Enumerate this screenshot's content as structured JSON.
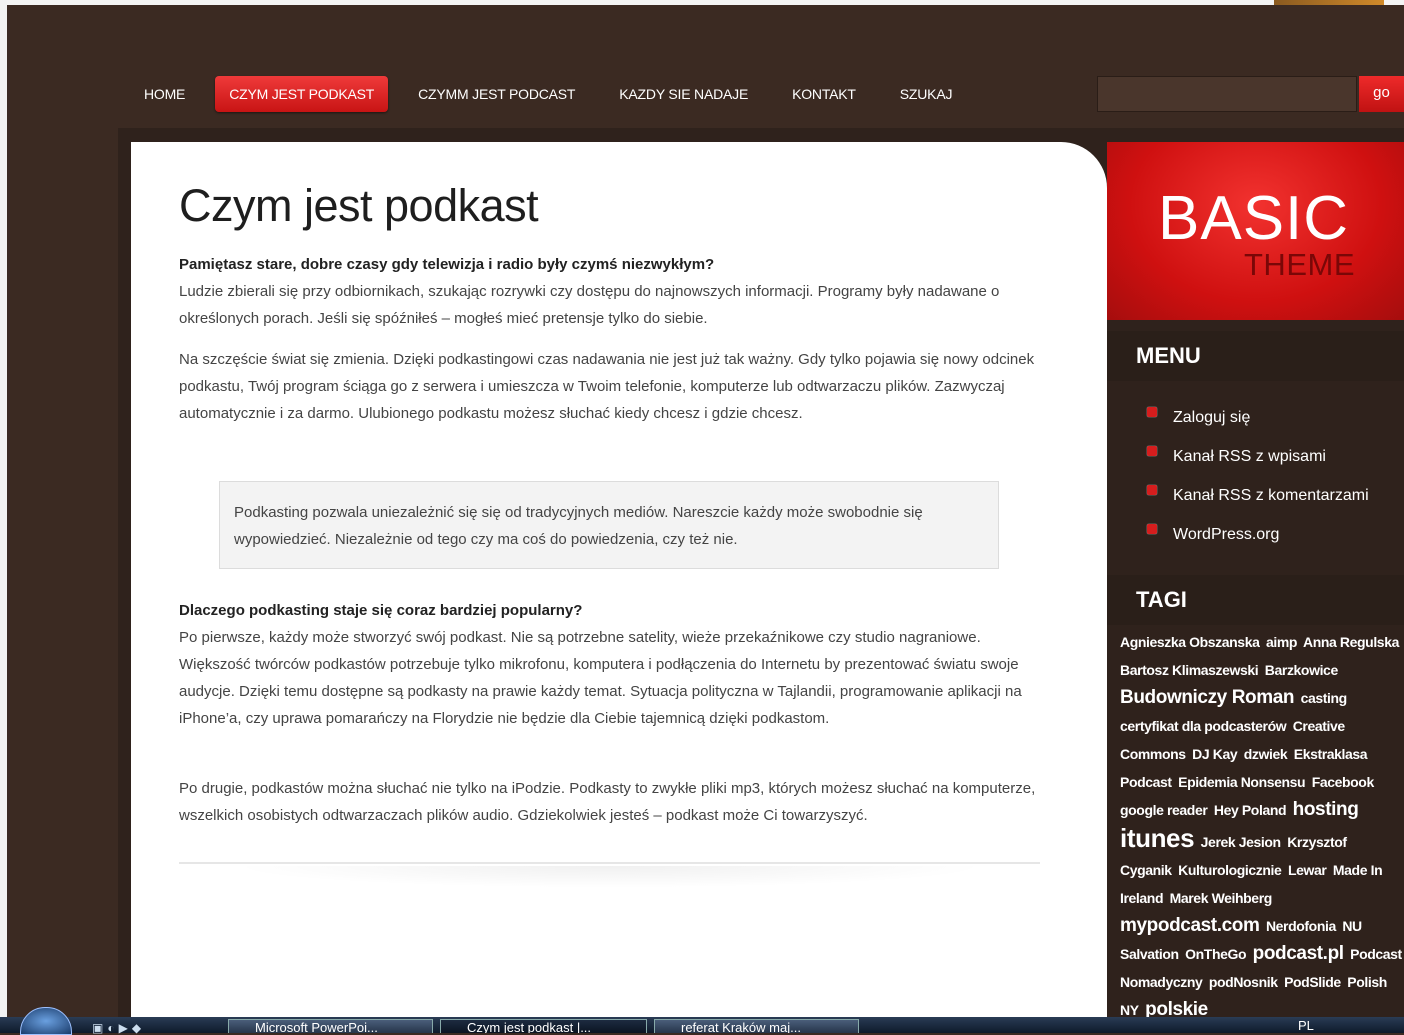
{
  "nav": {
    "items": [
      "HOME",
      "CZYM JEST PODKAST",
      "CZYMM JEST PODCAST",
      "KAZDY SIE NADAJE",
      "KONTAKT",
      "SZUKAJ"
    ],
    "active_index": 1
  },
  "search": {
    "button_label": "go",
    "value": ""
  },
  "page": {
    "title": "Czym jest podkast",
    "p1_bold": "Pamiętasz stare, dobre czasy gdy telewizja i radio były czymś niezwykłym?",
    "p1_text": "Ludzie zbierali się przy odbiornikach, szukając rozrywki czy dostępu do najnowszych informacji. Programy były nadawane o określonych porach. Jeśli się spóźniłeś – mogłeś mieć pretensje tylko do siebie.",
    "p2": "Na szczęście świat się zmienia. Dzięki podkastingowi czas nadawania nie jest już tak ważny. Gdy tylko pojawia się nowy odcinek podkastu, Twój program ściąga go z serwera i umieszcza w Twoim telefonie, komputerze lub odtwarzaczu plików. Zazwyczaj automatycznie i za darmo. Ulubionego podkastu możesz słuchać kiedy chcesz i gdzie chcesz.",
    "quote": "Podkasting pozwala uniezależnić się się od tradycyjnych mediów. Nareszcie każdy może swobodnie się wypowiedzieć. Niezależnie od tego czy ma coś do powiedzenia, czy też nie.",
    "p3_bold": "Dlaczego podkasting staje się coraz bardziej popularny?",
    "p3_text": "Po pierwsze, każdy może stworzyć swój podkast. Nie są potrzebne satelity, wieże przekaźnikowe czy studio nagraniowe. Większość twórców podkastów potrzebuje tylko mikrofonu, komputera i podłączenia do Internetu by prezentować światu swoje audycje. Dzięki temu dostępne są podkasty na prawie każdy temat. Sytuacja polityczna w Tajlandii, programowanie aplikacji na iPhone’a, czy uprawa pomarańczy na Florydzie nie będzie dla Ciebie tajemnicą dzięki podkastom.",
    "p4": "Po drugie, podkastów można słuchać nie tylko na iPodzie. Podkasty to zwykłe pliki mp3, których możesz słuchać na komputerze, wszelkich osobistych odtwarzaczach plików audio. Gdziekolwiek jesteś – podkast może Ci towarzyszyć."
  },
  "logo": {
    "main": "BASIC",
    "sub": "THEME"
  },
  "sidebar": {
    "menu_title": "MENU",
    "menu_items": [
      "Zaloguj się",
      "Kanał RSS z wpisami",
      "Kanał RSS z komentarzami",
      "WordPress.org"
    ],
    "tags_title": "TAGI",
    "tags": [
      {
        "t": "Agnieszka Obszanska",
        "s": "s"
      },
      {
        "t": "aimp",
        "s": "s"
      },
      {
        "t": "Anna Regulska",
        "s": "s"
      },
      {
        "t": "Bartosz Klimaszewski",
        "s": "s"
      },
      {
        "t": "Barzkowice",
        "s": "s"
      },
      {
        "t": "Budowniczy Roman",
        "s": "m"
      },
      {
        "t": "casting",
        "s": "s"
      },
      {
        "t": "certyfikat dla podcasterów",
        "s": "s"
      },
      {
        "t": "Creative Commons",
        "s": "s"
      },
      {
        "t": "DJ Kay",
        "s": "s"
      },
      {
        "t": "dzwiek",
        "s": "s"
      },
      {
        "t": "Ekstraklasa Podcast",
        "s": "s"
      },
      {
        "t": "Epidemia Nonsensu",
        "s": "s"
      },
      {
        "t": "Facebook",
        "s": "s"
      },
      {
        "t": "google reader",
        "s": "s"
      },
      {
        "t": "Hey Poland",
        "s": "s"
      },
      {
        "t": "hosting",
        "s": "m"
      },
      {
        "t": "itunes",
        "s": "l"
      },
      {
        "t": "Jerek Jesion",
        "s": "s"
      },
      {
        "t": "Krzysztof Cyganik",
        "s": "s"
      },
      {
        "t": "Kulturologicznie",
        "s": "s"
      },
      {
        "t": "Lewar",
        "s": "s"
      },
      {
        "t": "Made In Ireland",
        "s": "s"
      },
      {
        "t": "Marek Weihberg",
        "s": "s"
      },
      {
        "t": "mypodcast.com",
        "s": "m"
      },
      {
        "t": "Nerdofonia",
        "s": "s"
      },
      {
        "t": "NU Salvation",
        "s": "s"
      },
      {
        "t": "OnTheGo",
        "s": "s"
      },
      {
        "t": "podcast.pl",
        "s": "m"
      },
      {
        "t": "Podcast Nomadyczny",
        "s": "s"
      },
      {
        "t": "podNosnik",
        "s": "s"
      },
      {
        "t": "PodSlide",
        "s": "s"
      },
      {
        "t": "Polish NY",
        "s": "s"
      },
      {
        "t": "polskie",
        "s": "m"
      }
    ]
  },
  "taskbar": {
    "buttons": [
      "Microsoft PowerPoi...",
      "Czym jest podkast |...",
      "referat Kraków maj..."
    ],
    "lang": "PL"
  }
}
